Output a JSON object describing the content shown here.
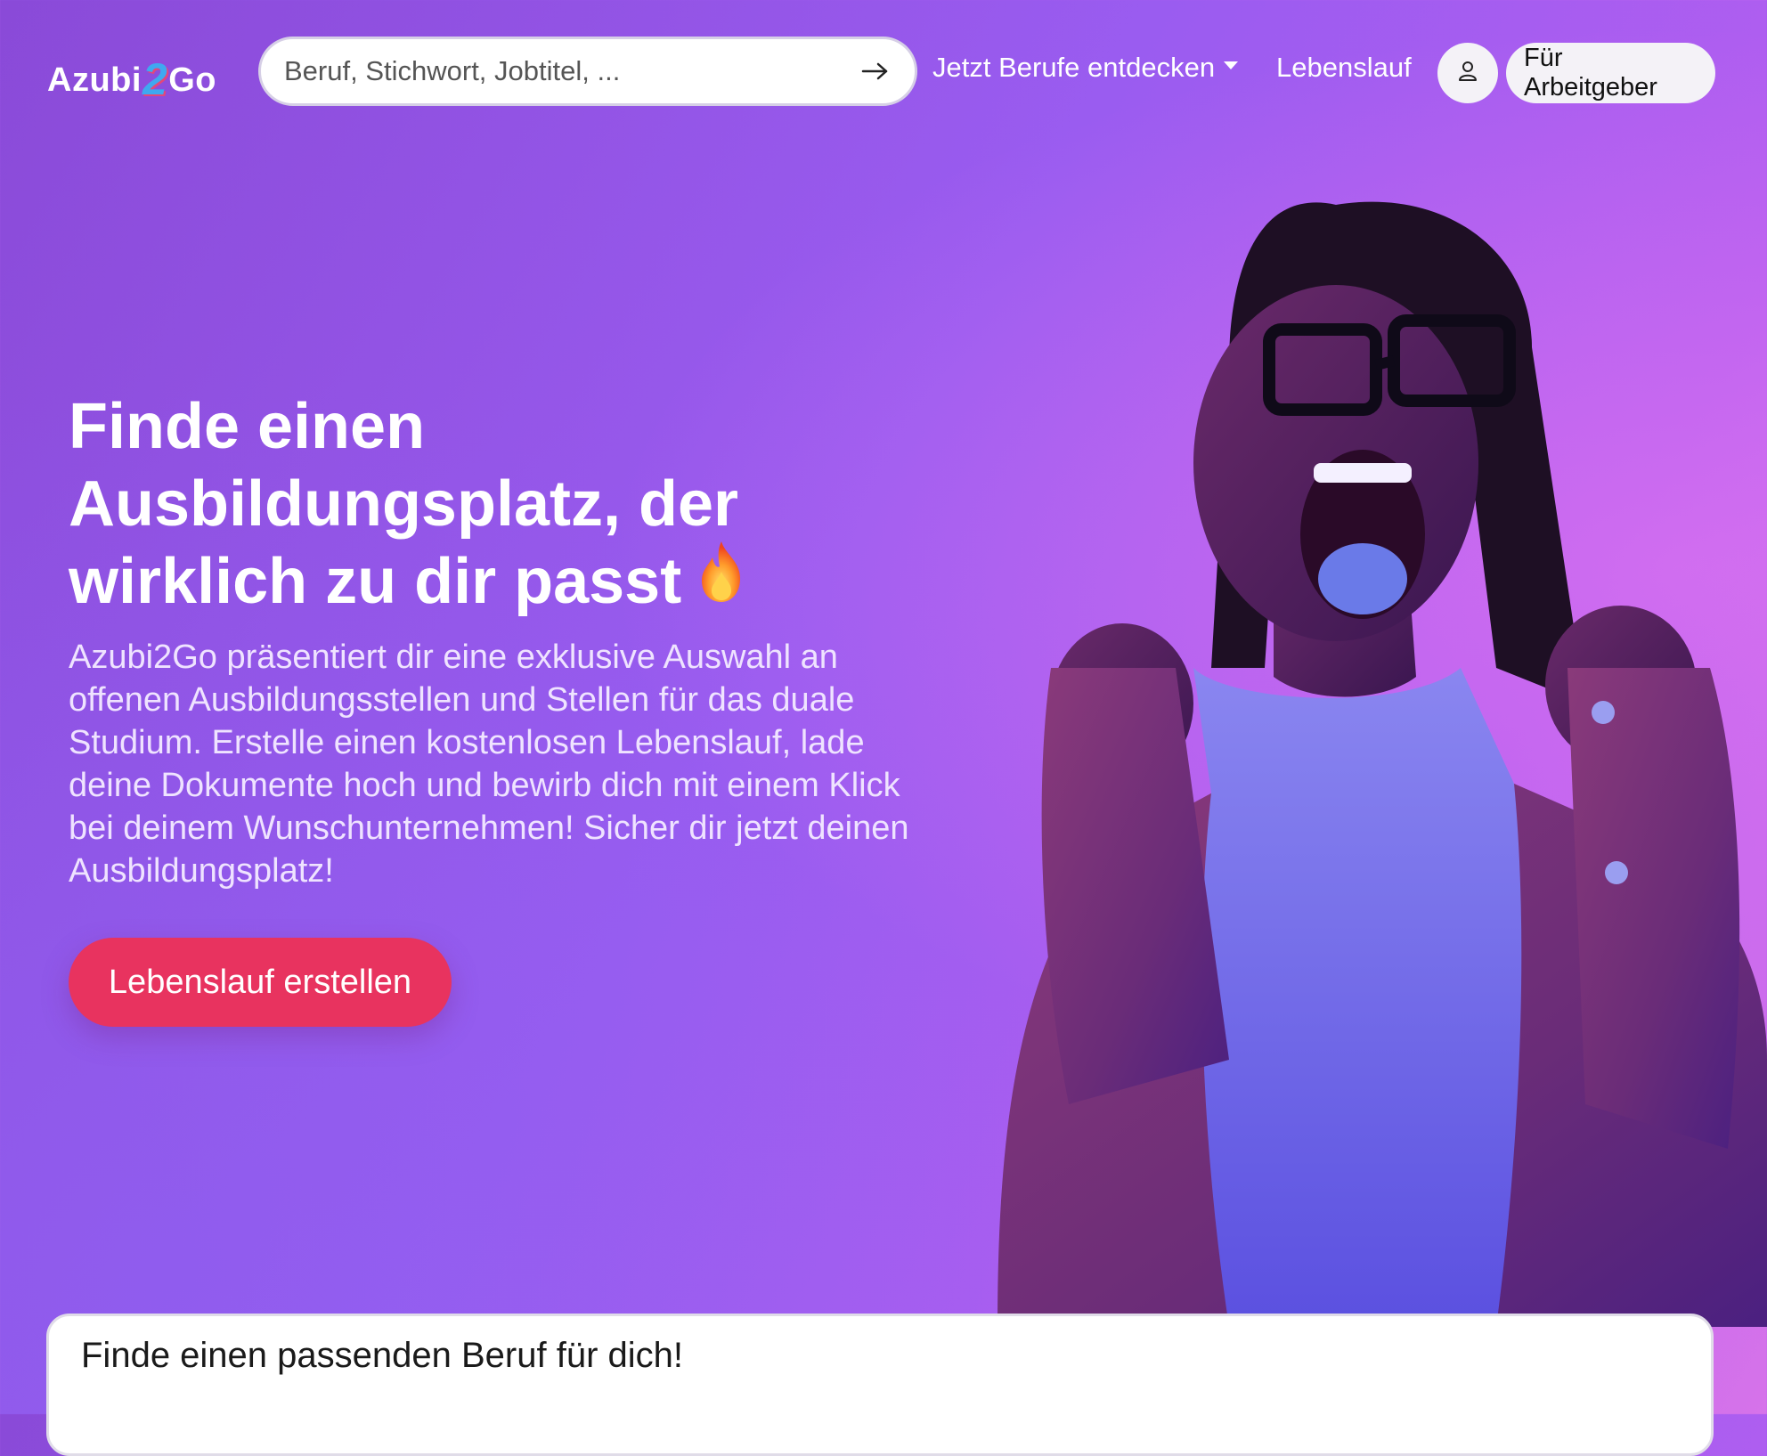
{
  "header": {
    "logo_prefix": "Azubi",
    "logo_mid": "2",
    "logo_suffix": "Go",
    "search": {
      "placeholder": "Beruf, Stichwort, Jobtitel, ..."
    },
    "nav": {
      "discover_label": "Jetzt Berufe entdecken",
      "cv_label": "Lebenslauf",
      "employer_label": "Für Arbeitgeber"
    }
  },
  "hero": {
    "title_line1": "Finde einen",
    "title_line2": "Ausbildungsplatz, der",
    "title_line3": "wirklich zu dir passt",
    "description": "Azubi2Go präsentiert dir eine exklusive Auswahl an offenen Ausbildungsstellen und Stellen für das duale Studium. Erstelle einen kostenlosen Lebenslauf, lade deine Dokumente hoch und bewirb dich mit einem Klick bei deinem Wunschunternehmen! Sicher dir jetzt deinen Ausbildungsplatz!",
    "cta_label": "Lebenslauf erstellen"
  },
  "card": {
    "title": "Finde einen passenden Beruf für dich!"
  },
  "colors": {
    "accent": "#e8335f",
    "background_start": "#8a4ad8",
    "background_end": "#d673ea"
  },
  "icons": {
    "search_submit": "arrow-right-icon",
    "user": "user-icon",
    "dropdown": "caret-down-icon",
    "emoji": "fire-icon"
  }
}
